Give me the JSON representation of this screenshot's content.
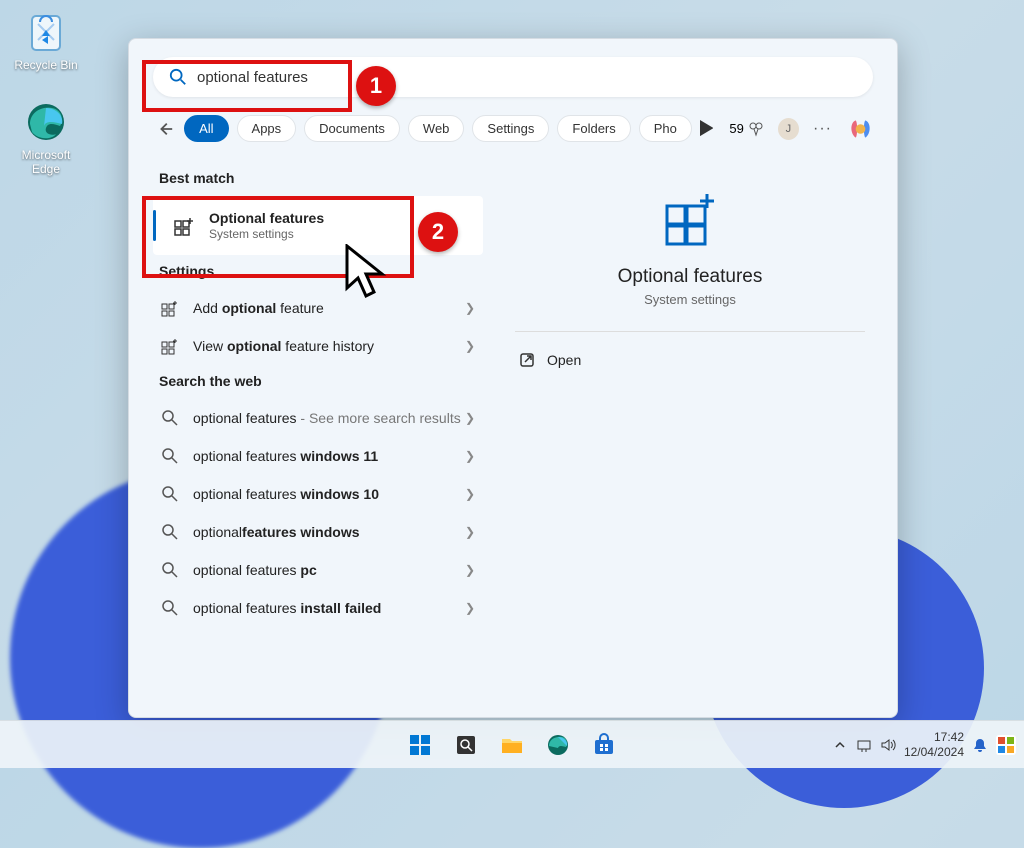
{
  "desktop": {
    "icons": [
      {
        "label": "Recycle Bin"
      },
      {
        "label": "Microsoft Edge"
      }
    ]
  },
  "search": {
    "query": "optional features",
    "filters": {
      "all": "All",
      "apps": "Apps",
      "documents": "Documents",
      "web": "Web",
      "settings": "Settings",
      "folders": "Folders",
      "photos": "Pho"
    },
    "rewards": "59",
    "user_initial": "J"
  },
  "results": {
    "best_match_label": "Best match",
    "best_match": {
      "title": "Optional features",
      "subtitle": "System settings"
    },
    "settings_label": "Settings",
    "settings_items": [
      {
        "prefix": "Add ",
        "bold": "optional",
        "suffix": " feature"
      },
      {
        "prefix": "View ",
        "bold": "optional",
        "suffix": " feature history"
      }
    ],
    "web_label": "Search the web",
    "web_items": [
      {
        "prefix": "optional features",
        "suffix": " - See more search results"
      },
      {
        "prefix": "optional features ",
        "bold": "windows 11"
      },
      {
        "prefix": "optional features ",
        "bold": "windows 10"
      },
      {
        "prefix": "optional",
        "bold": "features windows"
      },
      {
        "prefix": "optional features ",
        "bold": "pc"
      },
      {
        "prefix": "optional features ",
        "bold": "install failed"
      }
    ]
  },
  "preview": {
    "title": "Optional features",
    "subtitle": "System settings",
    "action_open": "Open"
  },
  "annotations": {
    "step1": "1",
    "step2": "2"
  },
  "taskbar": {
    "time": "17:42",
    "date": "12/04/2024"
  }
}
